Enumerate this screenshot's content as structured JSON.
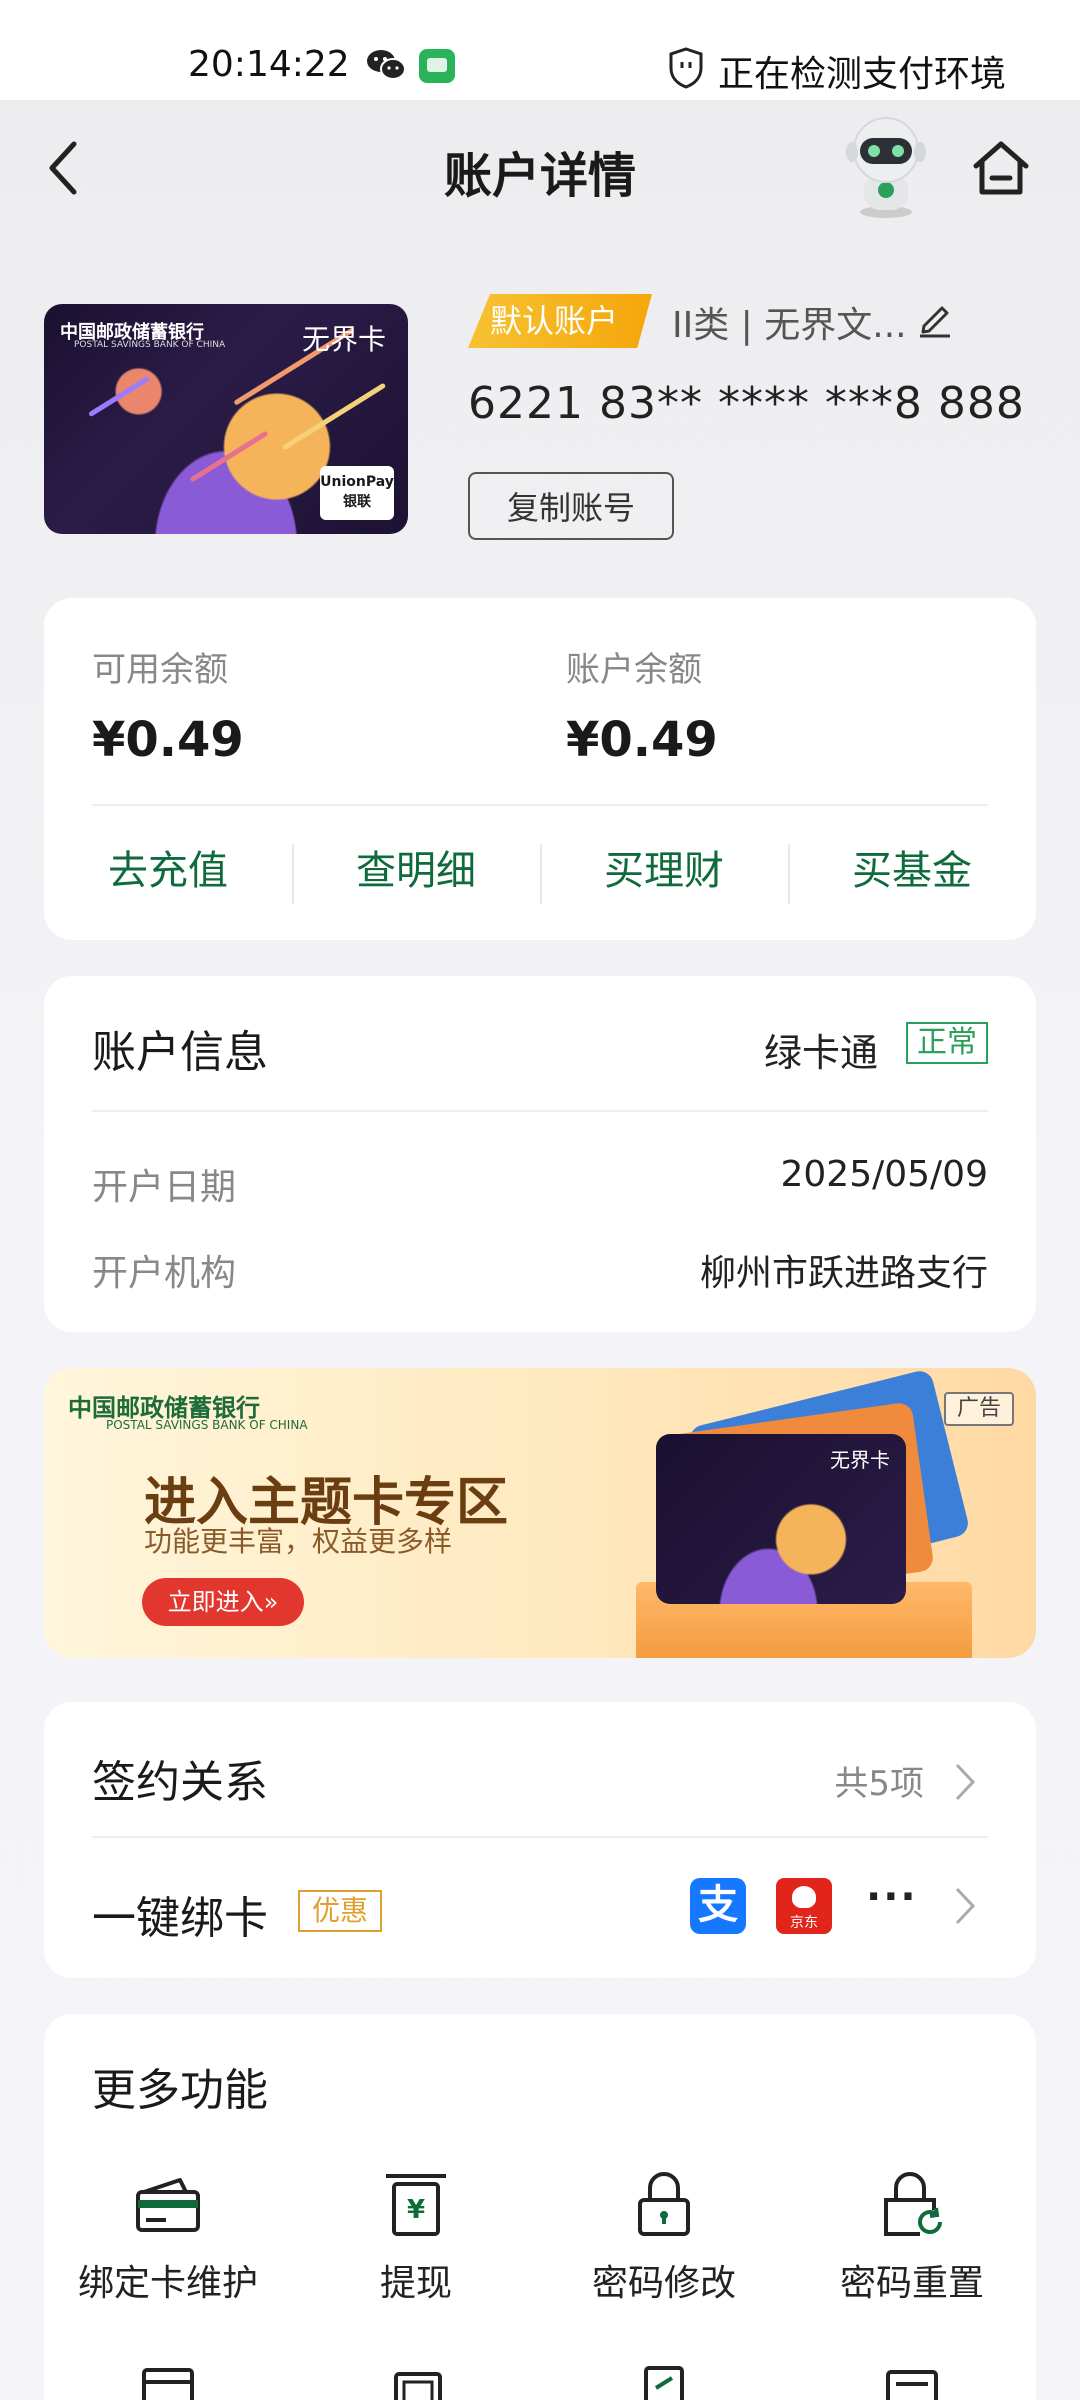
{
  "status_bar": {
    "time": "20:14:22",
    "security_text": "正在检测支付环境"
  },
  "nav": {
    "title": "账户详情"
  },
  "card": {
    "bank_name": "中国邮政储蓄银行",
    "bank_name_en": "POSTAL SAVINGS BANK OF CHINA",
    "card_name": "无界卡",
    "union_pay": "UnionPay",
    "union_pay_cn": "银联",
    "default_badge": "默认账户",
    "account_type": "II类 | 无界文...",
    "account_number": "6221 83** **** ***8 888",
    "copy_button": "复制账号"
  },
  "balance": {
    "available_label": "可用余额",
    "available_value": "¥0.49",
    "account_label": "账户余额",
    "account_value": "¥0.49",
    "actions": [
      "去充值",
      "查明细",
      "买理财",
      "买基金"
    ]
  },
  "account_info": {
    "title": "账户信息",
    "card_type": "绿卡通",
    "status": "正常",
    "rows": [
      {
        "label": "开户日期",
        "value": "2025/05/09"
      },
      {
        "label": "开户机构",
        "value": "柳州市跃进路支行"
      }
    ]
  },
  "ad": {
    "bank_name": "中国邮政储蓄银行",
    "bank_name_en": "POSTAL SAVINGS BANK OF CHINA",
    "title": "进入主题卡专区",
    "subtitle": "功能更丰富，权益更多样",
    "button": "立即进入»",
    "tag": "广告",
    "card_name": "无界卡"
  },
  "signing": {
    "title": "签约关系",
    "count": "共5项",
    "bind_title": "一键绑卡",
    "promo_badge": "优惠",
    "alipay_glyph": "支",
    "jd_label": "京东",
    "more": "···"
  },
  "more_functions": {
    "title": "更多功能",
    "items": [
      {
        "label": "绑定卡维护",
        "icon": "card-maintenance-icon"
      },
      {
        "label": "提现",
        "icon": "withdraw-icon"
      },
      {
        "label": "密码修改",
        "icon": "lock-icon"
      },
      {
        "label": "密码重置",
        "icon": "lock-reset-icon"
      }
    ]
  },
  "colors": {
    "brand_green": "#0f6b3c",
    "badge_yellow": "#f5a60a",
    "status_green": "#2aa05a",
    "alipay_blue": "#1677ff",
    "jd_red": "#e1251b"
  }
}
